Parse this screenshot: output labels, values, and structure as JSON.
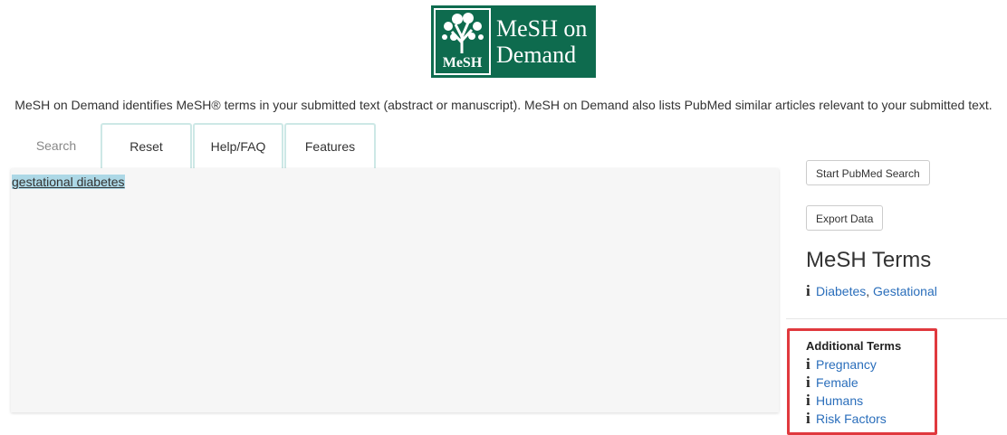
{
  "logo": {
    "line1": "MeSH on",
    "line2": "Demand",
    "emblem_text": "MeSH",
    "bg_color": "#0e6b4e"
  },
  "intro_text": "MeSH on Demand identifies MeSH® terms in your submitted text (abstract or manuscript). MeSH on Demand also lists PubMed similar articles relevant to your submitted text.",
  "tabs": [
    {
      "label": "Search"
    },
    {
      "label": "Reset"
    },
    {
      "label": "Help/FAQ"
    },
    {
      "label": "Features"
    }
  ],
  "editor": {
    "text": "gestational diabetes"
  },
  "buttons": {
    "pubmed": "Start PubMed Search",
    "export": "Export Data"
  },
  "mesh_terms": {
    "heading": "MeSH Terms",
    "items": [
      {
        "part1": "Diabetes",
        "sep": ", ",
        "part2": "Gestational"
      }
    ]
  },
  "additional_terms": {
    "heading": "Additional Terms",
    "items": [
      "Pregnancy",
      "Female",
      "Humans",
      "Risk Factors"
    ]
  },
  "colors": {
    "link": "#2a6ebb",
    "highlight": "#e0393e",
    "tab_border": "#cde8e6",
    "selection": "#add8e6"
  },
  "icons": {
    "info": "i"
  }
}
